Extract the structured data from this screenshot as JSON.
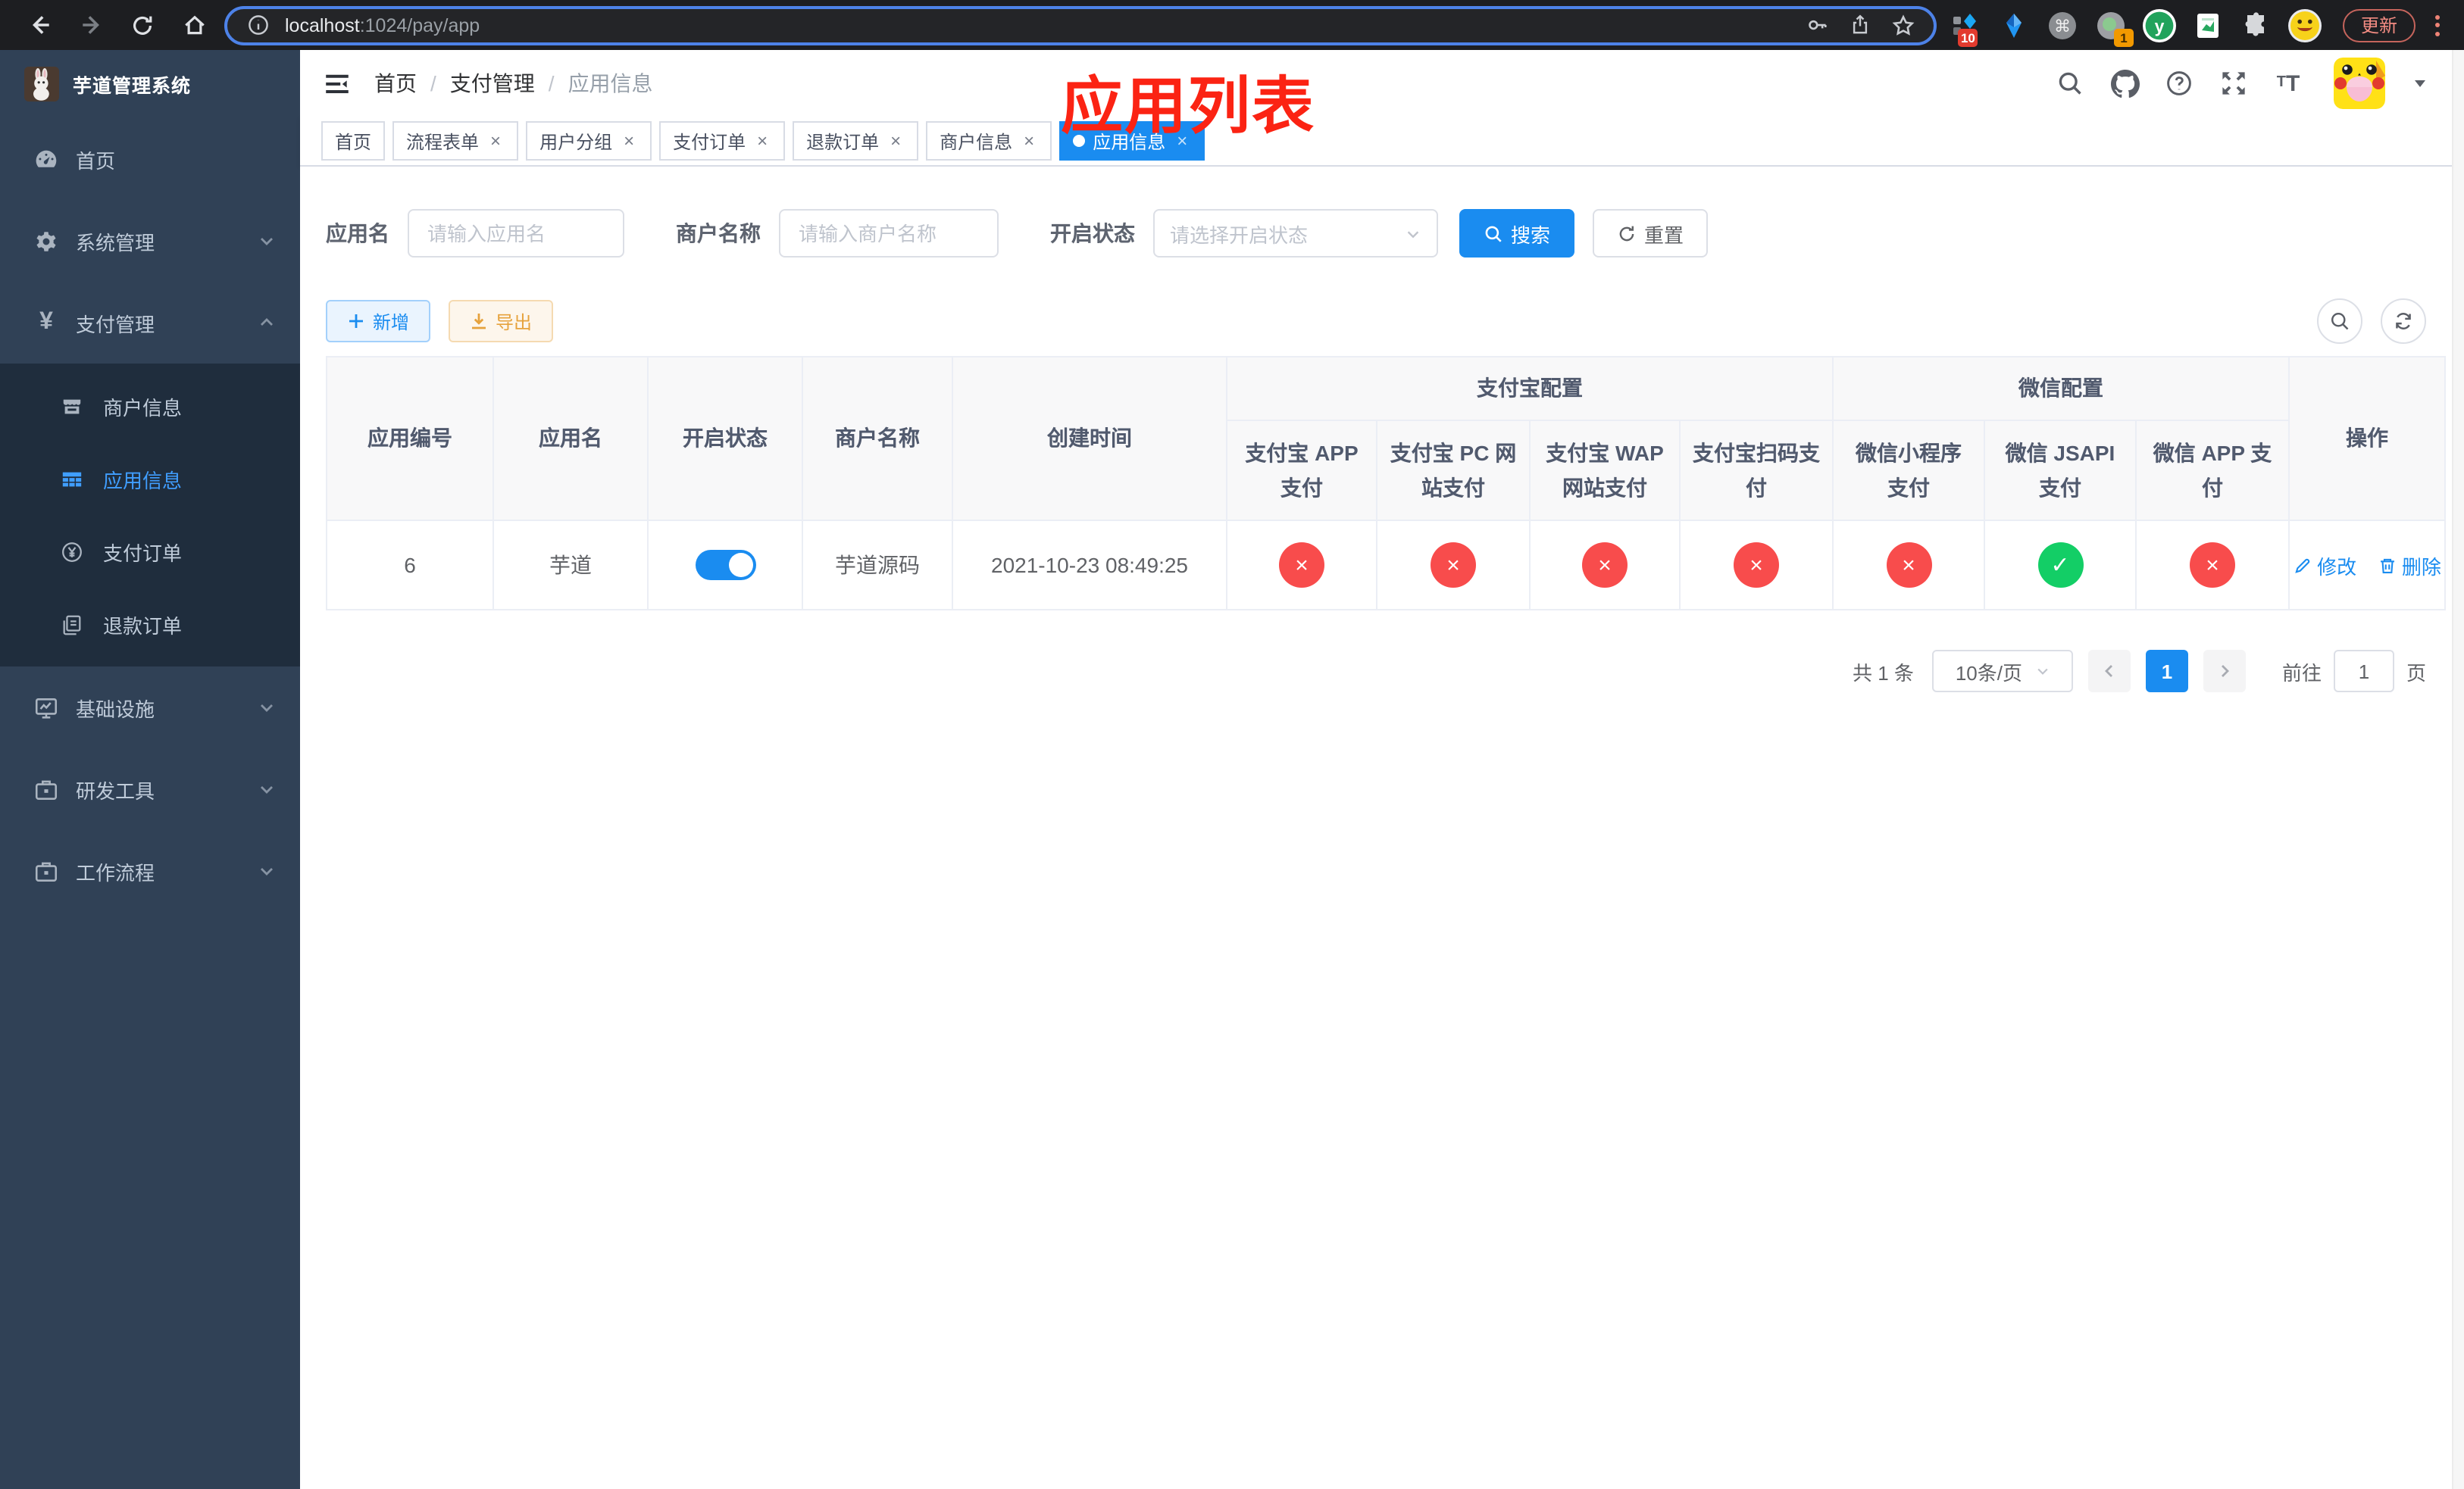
{
  "browser": {
    "url_host": "localhost",
    "url_rest": ":1024/pay/app",
    "update_label": "更新",
    "ext_badge_blue_diamond": "10",
    "ext_badge_gray_circle": "1"
  },
  "sidebar": {
    "title": "芋道管理系统",
    "items": [
      {
        "label": "首页"
      },
      {
        "label": "系统管理"
      },
      {
        "label": "支付管理"
      },
      {
        "label": "商户信息"
      },
      {
        "label": "应用信息"
      },
      {
        "label": "支付订单"
      },
      {
        "label": "退款订单"
      },
      {
        "label": "基础设施"
      },
      {
        "label": "研发工具"
      },
      {
        "label": "工作流程"
      }
    ]
  },
  "navbar": {
    "breadcrumb": [
      "首页",
      "支付管理",
      "应用信息"
    ]
  },
  "annotation": {
    "title": "应用列表",
    "color": "#fb2313"
  },
  "tabs": [
    {
      "label": "首页",
      "closable": false,
      "active": false
    },
    {
      "label": "流程表单",
      "closable": true,
      "active": false
    },
    {
      "label": "用户分组",
      "closable": true,
      "active": false
    },
    {
      "label": "支付订单",
      "closable": true,
      "active": false
    },
    {
      "label": "退款订单",
      "closable": true,
      "active": false
    },
    {
      "label": "商户信息",
      "closable": true,
      "active": false
    },
    {
      "label": "应用信息",
      "closable": true,
      "active": true
    }
  ],
  "filters": {
    "app_name_label": "应用名",
    "app_name_placeholder": "请输入应用名",
    "merchant_label": "商户名称",
    "merchant_placeholder": "请输入商户名称",
    "status_label": "开启状态",
    "status_placeholder": "请选择开启状态",
    "search_label": "搜索",
    "reset_label": "重置"
  },
  "toolbar": {
    "add_label": "新增",
    "export_label": "导出"
  },
  "table": {
    "columns_left": [
      "应用编号",
      "应用名",
      "开启状态",
      "商户名称",
      "创建时间"
    ],
    "groups": [
      {
        "label": "支付宝配置",
        "children": [
          "支付宝 APP 支付",
          "支付宝 PC 网站支付",
          "支付宝 WAP 网站支付",
          "支付宝扫码支付"
        ]
      },
      {
        "label": "微信配置",
        "children": [
          "微信小程序支付",
          "微信 JSAPI 支付",
          "微信 APP 支付"
        ]
      }
    ],
    "actions_column": "操作",
    "row": {
      "id": "6",
      "name": "芋道",
      "enabled": true,
      "merchant": "芋道源码",
      "created_at": "2021-10-23 08:49:25",
      "channels": [
        false,
        false,
        false,
        false,
        false,
        true,
        false
      ],
      "edit_label": "修改",
      "delete_label": "删除"
    }
  },
  "pagination": {
    "total_label": "共 1 条",
    "page_size_label": "10条/页",
    "current_page": "1",
    "goto_label": "前往",
    "goto_value": "1",
    "page_unit": "页"
  },
  "colors": {
    "accent": "#1a8cf0",
    "success": "#13ce66",
    "danger": "#f84c4c",
    "sidebar_bg": "#304156",
    "submenu_bg": "#1f2d3d"
  }
}
